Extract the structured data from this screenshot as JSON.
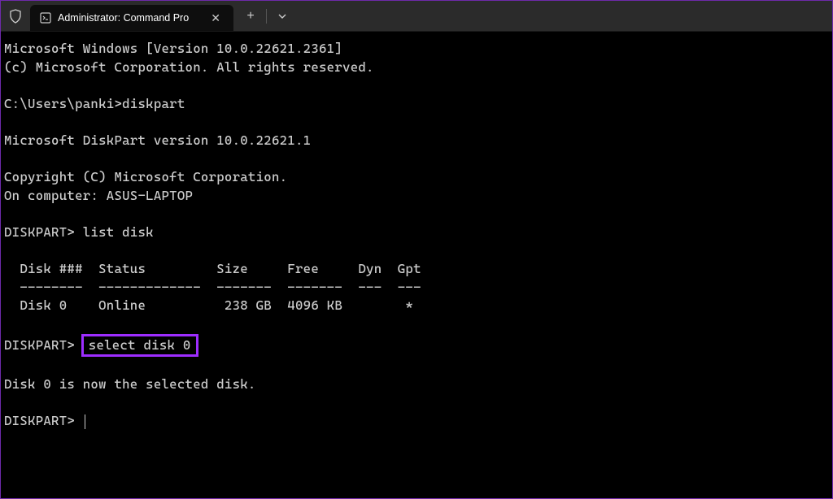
{
  "titlebar": {
    "tab_title": "Administrator: Command Pro"
  },
  "terminal": {
    "line1": "Microsoft Windows [Version 10.0.22621.2361]",
    "line2": "(c) Microsoft Corporation. All rights reserved.",
    "prompt1": "C:\\Users\\panki>",
    "cmd1": "diskpart",
    "line3": "Microsoft DiskPart version 10.0.22621.1",
    "line4": "Copyright (C) Microsoft Corporation.",
    "line5": "On computer: ASUS-LAPTOP",
    "prompt2": "DISKPART> ",
    "cmd2": "list disk",
    "table_header": "  Disk ###  Status         Size     Free     Dyn  Gpt",
    "table_divider": "  --------  -------------  -------  -------  ---  ---",
    "table_row1": "  Disk 0    Online          238 GB  4096 KB        *",
    "prompt3": "DISKPART>",
    "cmd3": "select disk 0",
    "line6": "Disk 0 is now the selected disk.",
    "prompt4": "DISKPART> "
  },
  "disk_table": {
    "columns": [
      "Disk ###",
      "Status",
      "Size",
      "Free",
      "Dyn",
      "Gpt"
    ],
    "rows": [
      {
        "disk": "Disk 0",
        "status": "Online",
        "size": "238 GB",
        "free": "4096 KB",
        "dyn": "",
        "gpt": "*"
      }
    ]
  }
}
